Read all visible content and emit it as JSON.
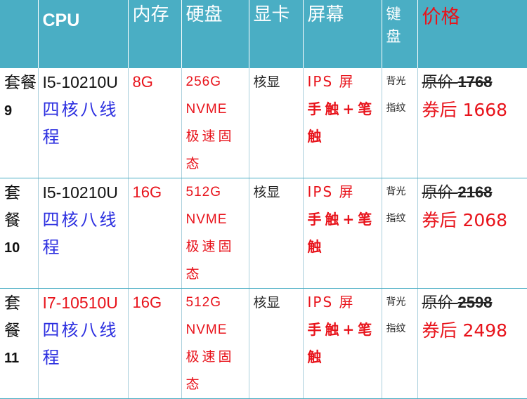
{
  "headers": {
    "package": "",
    "cpu": "CPU",
    "memory": "内存",
    "disk": "硬盘",
    "gpu": "显卡",
    "screen": "屏幕",
    "keyboard_line1": "键",
    "keyboard_line2": "盘",
    "price": "价格"
  },
  "rows": [
    {
      "package_label": "套餐",
      "package_number": "9",
      "cpu_model": "I5-10210U",
      "cpu_desc_1": "四核八线",
      "cpu_desc_2": "程",
      "memory": "8G",
      "disk_1": "256G",
      "disk_2": "NVME",
      "disk_3": "极速固",
      "disk_4": "态",
      "gpu": "核显",
      "screen_1": "IPS 屏",
      "screen_2": "手触+笔",
      "screen_3": "触",
      "keyboard_1": "背光",
      "keyboard_2": "指纹",
      "original_label": "原价 ",
      "original_price": "1768",
      "after_coupon": "券后 1668"
    },
    {
      "package_label_1": "套",
      "package_label_2": "餐",
      "package_number": "10",
      "cpu_model": "I5-10210U",
      "cpu_desc_1": "四核八线",
      "cpu_desc_2": "程",
      "memory": "16G",
      "disk_1": "512G",
      "disk_2": "NVME",
      "disk_3": "极速固",
      "disk_4": "态",
      "gpu": "核显",
      "screen_1": "IPS 屏",
      "screen_2": "手触+笔",
      "screen_3": "触",
      "keyboard_1": "背光",
      "keyboard_2": "指纹",
      "original_label": "原价 ",
      "original_price": "2168",
      "after_coupon": "券后 2068"
    },
    {
      "package_label_1": "套",
      "package_label_2": "餐",
      "package_number": "11",
      "cpu_model": "I7-10510U",
      "cpu_desc_1": "四核八线",
      "cpu_desc_2": "程",
      "memory": "16G",
      "disk_1": "512G",
      "disk_2": "NVME",
      "disk_3": "极速固",
      "disk_4": "态",
      "gpu": "核显",
      "screen_1": "IPS 屏",
      "screen_2": "手触+笔",
      "screen_3": "触",
      "keyboard_1": "背光",
      "keyboard_2": "指纹",
      "original_label": "原价 ",
      "original_price": "2598",
      "after_coupon": "券后 2498"
    }
  ],
  "colors": {
    "header_bg": "#4aaec4",
    "header_text": "#ffffff",
    "price_header": "#e8131b",
    "accent_red": "#e8131b",
    "cpu_desc_blue": "#2b2ee0"
  }
}
